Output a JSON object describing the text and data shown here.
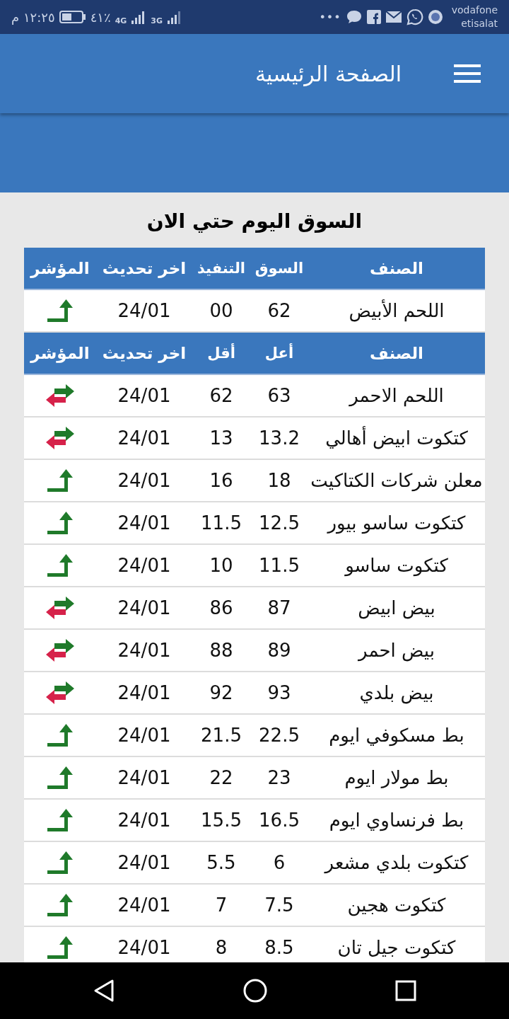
{
  "status_bar": {
    "time": "١٢:٢٥ م",
    "battery": "٤١٪",
    "network_1": "4G",
    "network_2": "3G",
    "carrier_1": "vodafone",
    "carrier_2": "etisalat",
    "more": "•••"
  },
  "app_bar": {
    "title": "الصفحة الرئيسية"
  },
  "section_title": "السوق اليوم حتي الان",
  "summary_table": {
    "columns": [
      "الصنف",
      "السوق",
      "التنفيذ",
      "اخر تحديث",
      "المؤشر"
    ],
    "rows": [
      {
        "item": "اللحم الأبيض",
        "market": "62",
        "execution": "00",
        "updated": "24/01",
        "kind": "up"
      }
    ]
  },
  "prices_table": {
    "columns": [
      "الصنف",
      "أعل",
      "أقل",
      "اخر تحديث",
      "المؤشر"
    ],
    "rows": [
      {
        "item": "اللحم الاحمر",
        "high": "63",
        "low": "62",
        "updated": "24/01",
        "kind": "flat"
      },
      {
        "item": "كتكوت ابيض أهالي",
        "high": "13.2",
        "low": "13",
        "updated": "24/01",
        "kind": "flat"
      },
      {
        "item": "معلن شركات الكتاكيت",
        "high": "18",
        "low": "16",
        "updated": "24/01",
        "kind": "up"
      },
      {
        "item": "كتكوت ساسو بيور",
        "high": "12.5",
        "low": "11.5",
        "updated": "24/01",
        "kind": "up"
      },
      {
        "item": "كتكوت ساسو",
        "high": "11.5",
        "low": "10",
        "updated": "24/01",
        "kind": "up"
      },
      {
        "item": "بيض ابيض",
        "high": "87",
        "low": "86",
        "updated": "24/01",
        "kind": "flat"
      },
      {
        "item": "بيض احمر",
        "high": "89",
        "low": "88",
        "updated": "24/01",
        "kind": "flat"
      },
      {
        "item": "بيض بلدي",
        "high": "93",
        "low": "92",
        "updated": "24/01",
        "kind": "flat"
      },
      {
        "item": "بط مسكوفي ايوم",
        "high": "22.5",
        "low": "21.5",
        "updated": "24/01",
        "kind": "up"
      },
      {
        "item": "بط مولار ايوم",
        "high": "23",
        "low": "22",
        "updated": "24/01",
        "kind": "up"
      },
      {
        "item": "بط فرنساوي ايوم",
        "high": "16.5",
        "low": "15.5",
        "updated": "24/01",
        "kind": "up"
      },
      {
        "item": "كتكوت بلدي مشعر",
        "high": "6",
        "low": "5.5",
        "updated": "24/01",
        "kind": "up"
      },
      {
        "item": "كتكوت هجين",
        "high": "7.5",
        "low": "7",
        "updated": "24/01",
        "kind": "up"
      },
      {
        "item": "كتكوت جيل تان",
        "high": "8.5",
        "low": "8",
        "updated": "24/01",
        "kind": "up"
      }
    ]
  }
}
